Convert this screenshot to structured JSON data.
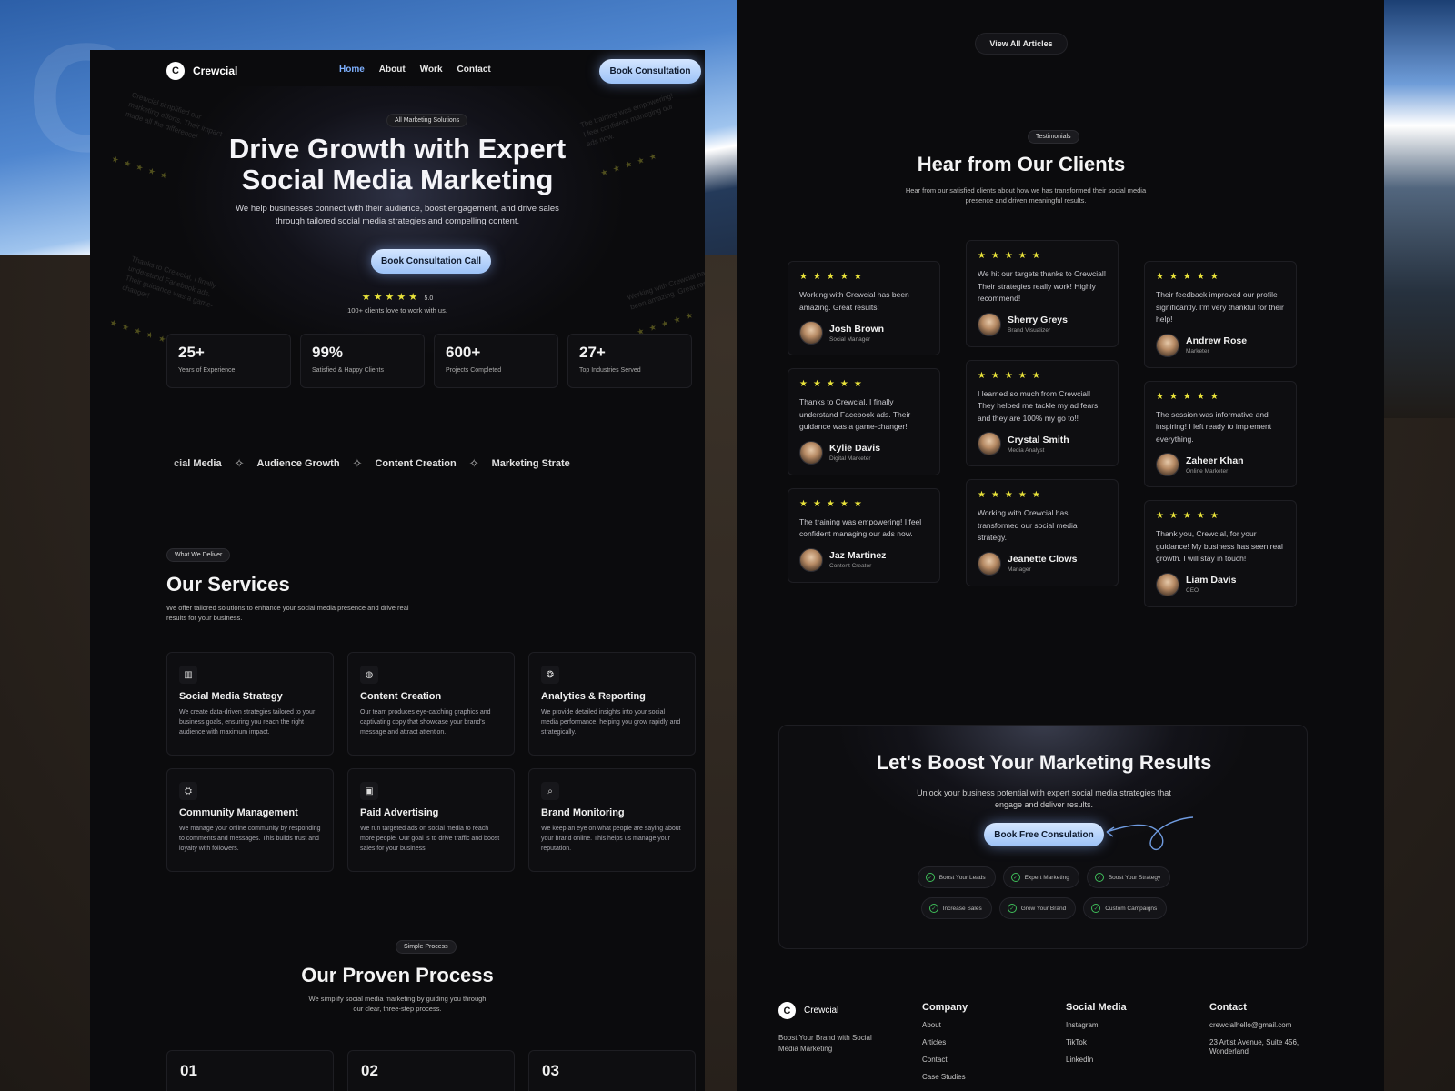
{
  "brand": {
    "name": "Crewcial",
    "logo_letter": "C"
  },
  "nav": {
    "links": [
      "Home",
      "About",
      "Work",
      "Contact"
    ],
    "active": "Home",
    "cta": "Book Consultation"
  },
  "hero": {
    "tag": "All Marketing Solutions",
    "title_line1": "Drive Growth with Expert",
    "title_line2": "Social Media Marketing",
    "subtitle": "We help businesses connect with their audience, boost engagement, and drive sales through tailored social media strategies and compelling content.",
    "cta": "Book Consultation Call",
    "stars": "★★★★★",
    "score": "5.0",
    "rating_caption": "100+ clients love to work with us."
  },
  "stats": [
    {
      "num": "25+",
      "label": "Years of Experience"
    },
    {
      "num": "99%",
      "label": "Satisfied & Happy Clients"
    },
    {
      "num": "600+",
      "label": "Projects Completed"
    },
    {
      "num": "27+",
      "label": "Top Industries Served"
    }
  ],
  "ticker": [
    "cial Media",
    "Audience Growth",
    "Content Creation",
    "Marketing Strate"
  ],
  "services": {
    "tag": "What We Deliver",
    "title": "Our Services",
    "subtitle": "We offer tailored solutions to enhance your social media presence and drive real results for your business.",
    "items": [
      {
        "icon": "bar-chart-icon",
        "glyph": "▥",
        "title": "Social Media Strategy",
        "desc": "We create data-driven strategies tailored to your business goals, ensuring you reach the right audience with maximum impact."
      },
      {
        "icon": "palette-icon",
        "glyph": "◍",
        "title": "Content Creation",
        "desc": "Our team produces eye-catching graphics and captivating copy that showcase your brand's message and attract attention."
      },
      {
        "icon": "analytics-icon",
        "glyph": "❂",
        "title": "Analytics & Reporting",
        "desc": "We provide detailed insights into your social media performance, helping you grow rapidly and strategically."
      },
      {
        "icon": "handshake-icon",
        "glyph": "⛭",
        "title": "Community Management",
        "desc": "We manage your online community by responding to comments and messages. This builds trust and loyalty with followers."
      },
      {
        "icon": "money-icon",
        "glyph": "▣",
        "title": "Paid Advertising",
        "desc": "We run targeted ads on social media to reach more people. Our goal is to drive traffic and boost sales for your business."
      },
      {
        "icon": "search-icon",
        "glyph": "⌕",
        "title": "Brand Monitoring",
        "desc": "We keep an eye on what people are saying about your brand online. This helps us manage your reputation."
      }
    ]
  },
  "process": {
    "tag": "Simple Process",
    "title": "Our Proven Process",
    "subtitle": "We simplify social media marketing by guiding you through our clear, three-step process.",
    "steps": [
      "01",
      "02",
      "03"
    ]
  },
  "articles": {
    "view_all": "View All Articles"
  },
  "testimonials": {
    "tag": "Testimonials",
    "title": "Hear from Our Clients",
    "subtitle": "Hear from our satisfied clients about how we has transformed their social media presence and driven meaningful results.",
    "stars": "★★★★★",
    "columns": [
      [
        {
          "text": "Working with Crewcial has been amazing. Great results!",
          "name": "Josh Brown",
          "role": "Social Manager"
        },
        {
          "text": "Thanks to Crewcial, I finally understand Facebook ads. Their guidance was a game-changer!",
          "name": "Kylie Davis",
          "role": "Digital Marketer"
        },
        {
          "text": "The training was empowering! I feel confident managing our ads now.",
          "name": "Jaz Martinez",
          "role": "Content Creator"
        }
      ],
      [
        {
          "text": "We hit our targets thanks to Crewcial! Their strategies really work! Highly recommend!",
          "name": "Sherry Greys",
          "role": "Brand Visualizer"
        },
        {
          "text": "I learned so much from Crewcial! They helped me tackle my ad fears and they are 100% my go to!!",
          "name": "Crystal Smith",
          "role": "Media Analyst"
        },
        {
          "text": "Working with Crewcial has transformed our social media strategy.",
          "name": "Jeanette Clows",
          "role": "Manager"
        }
      ],
      [
        {
          "text": "Their feedback improved our profile significantly. I'm very thankful for their help!",
          "name": "Andrew Rose",
          "role": "Marketer"
        },
        {
          "text": "The session was informative and inspiring! I left ready to implement everything.",
          "name": "Zaheer Khan",
          "role": "Online Marketer"
        },
        {
          "text": "Thank you, Crewcial, for your guidance! My business has seen real growth. I will stay in touch!",
          "name": "Liam Davis",
          "role": "CEO"
        }
      ]
    ]
  },
  "cta": {
    "title": "Let's Boost Your Marketing Results",
    "subtitle": "Unlock your business potential with expert social media strategies that engage and deliver results.",
    "button": "Book Free Consulation",
    "chips_row1": [
      "Boost Your Leads",
      "Expert Marketing",
      "Boost Your Strategy"
    ],
    "chips_row2": [
      "Increase Sales",
      "Grow Your Brand",
      "Custom Campaigns"
    ]
  },
  "footer": {
    "tagline": "Boost Your Brand with Social Media Marketing",
    "company": {
      "heading": "Company",
      "links": [
        "About",
        "Articles",
        "Contact",
        "Case Studies"
      ]
    },
    "social": {
      "heading": "Social Media",
      "links": [
        "Instagram",
        "TikTok",
        "LinkedIn"
      ]
    },
    "contact": {
      "heading": "Contact",
      "email": "crewcialhello@gmail.com",
      "address": "23 Artist Avenue, Suite 456, Wonderland"
    }
  }
}
